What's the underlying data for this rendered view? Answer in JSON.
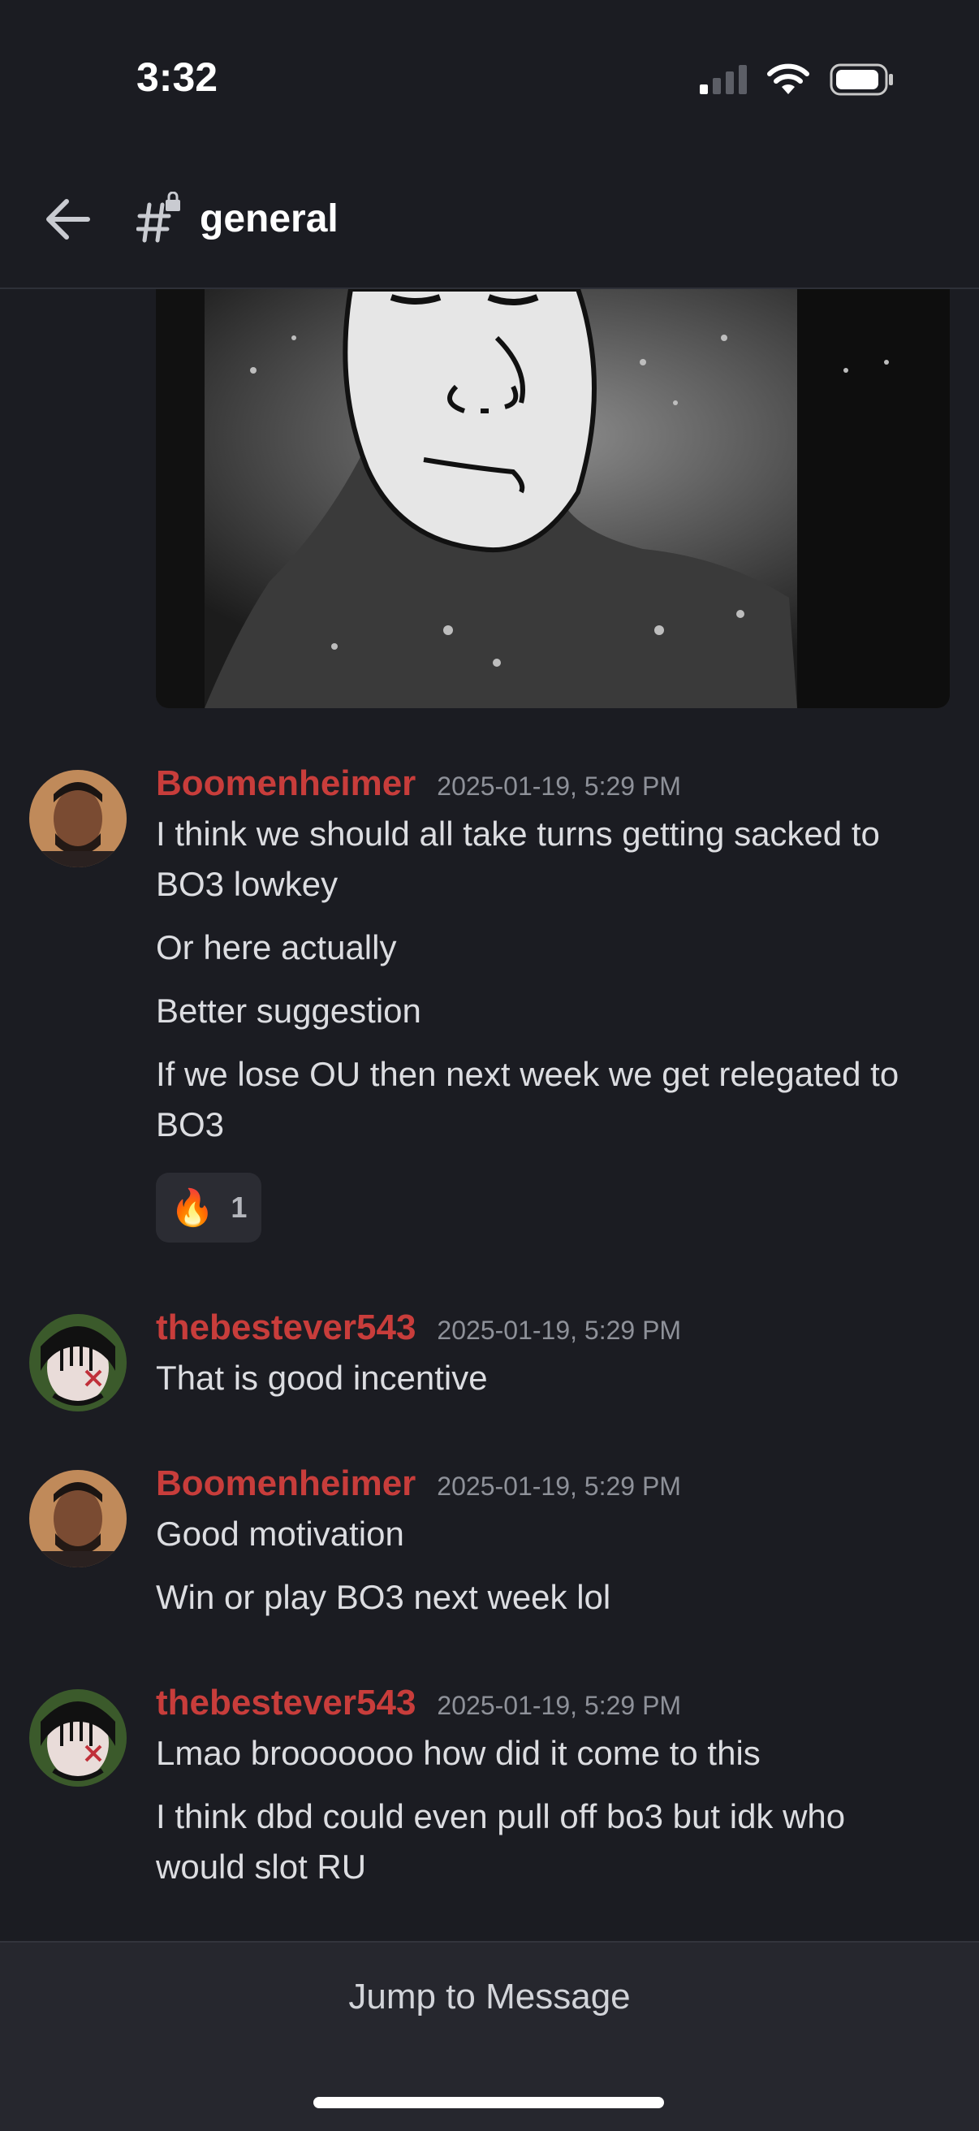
{
  "status_bar": {
    "time": "3:32",
    "icons": [
      "cellular-signal-icon",
      "wifi-icon",
      "battery-icon"
    ]
  },
  "header": {
    "channel_name": "general",
    "icons": [
      "back-arrow-icon",
      "locked-hash-icon"
    ]
  },
  "image_attachment": {
    "description_icon": "meme-image"
  },
  "groups": [
    {
      "username": "Boomenheimer",
      "timestamp": "2025-01-19, 5:29 PM",
      "messages": [
        "I think we should all take turns getting sacked to BO3 lowkey",
        "Or here actually",
        "Better suggestion",
        "If we lose OU then next week we get relegated to BO3"
      ],
      "reaction": {
        "emoji": "🔥",
        "count": "1"
      }
    },
    {
      "username": "thebestever543",
      "timestamp": "2025-01-19, 5:29 PM",
      "messages": [
        "That is good incentive"
      ]
    },
    {
      "username": "Boomenheimer",
      "timestamp": "2025-01-19, 5:29 PM",
      "messages": [
        "Good motivation",
        "Win or play BO3 next week lol"
      ]
    },
    {
      "username": "thebestever543",
      "timestamp": "2025-01-19, 5:29 PM",
      "messages": [
        "Lmao brooooooo how did it come to this",
        "I think dbd could even pull off bo3 but idk who would slot RU"
      ]
    }
  ],
  "jump_bar": {
    "label": "Jump to Message"
  },
  "colors": {
    "background": "#1b1c22",
    "username": "#c83d3b",
    "timestamp": "#8e9199",
    "text": "#dcdde1",
    "jump_bar": "#26272e"
  }
}
